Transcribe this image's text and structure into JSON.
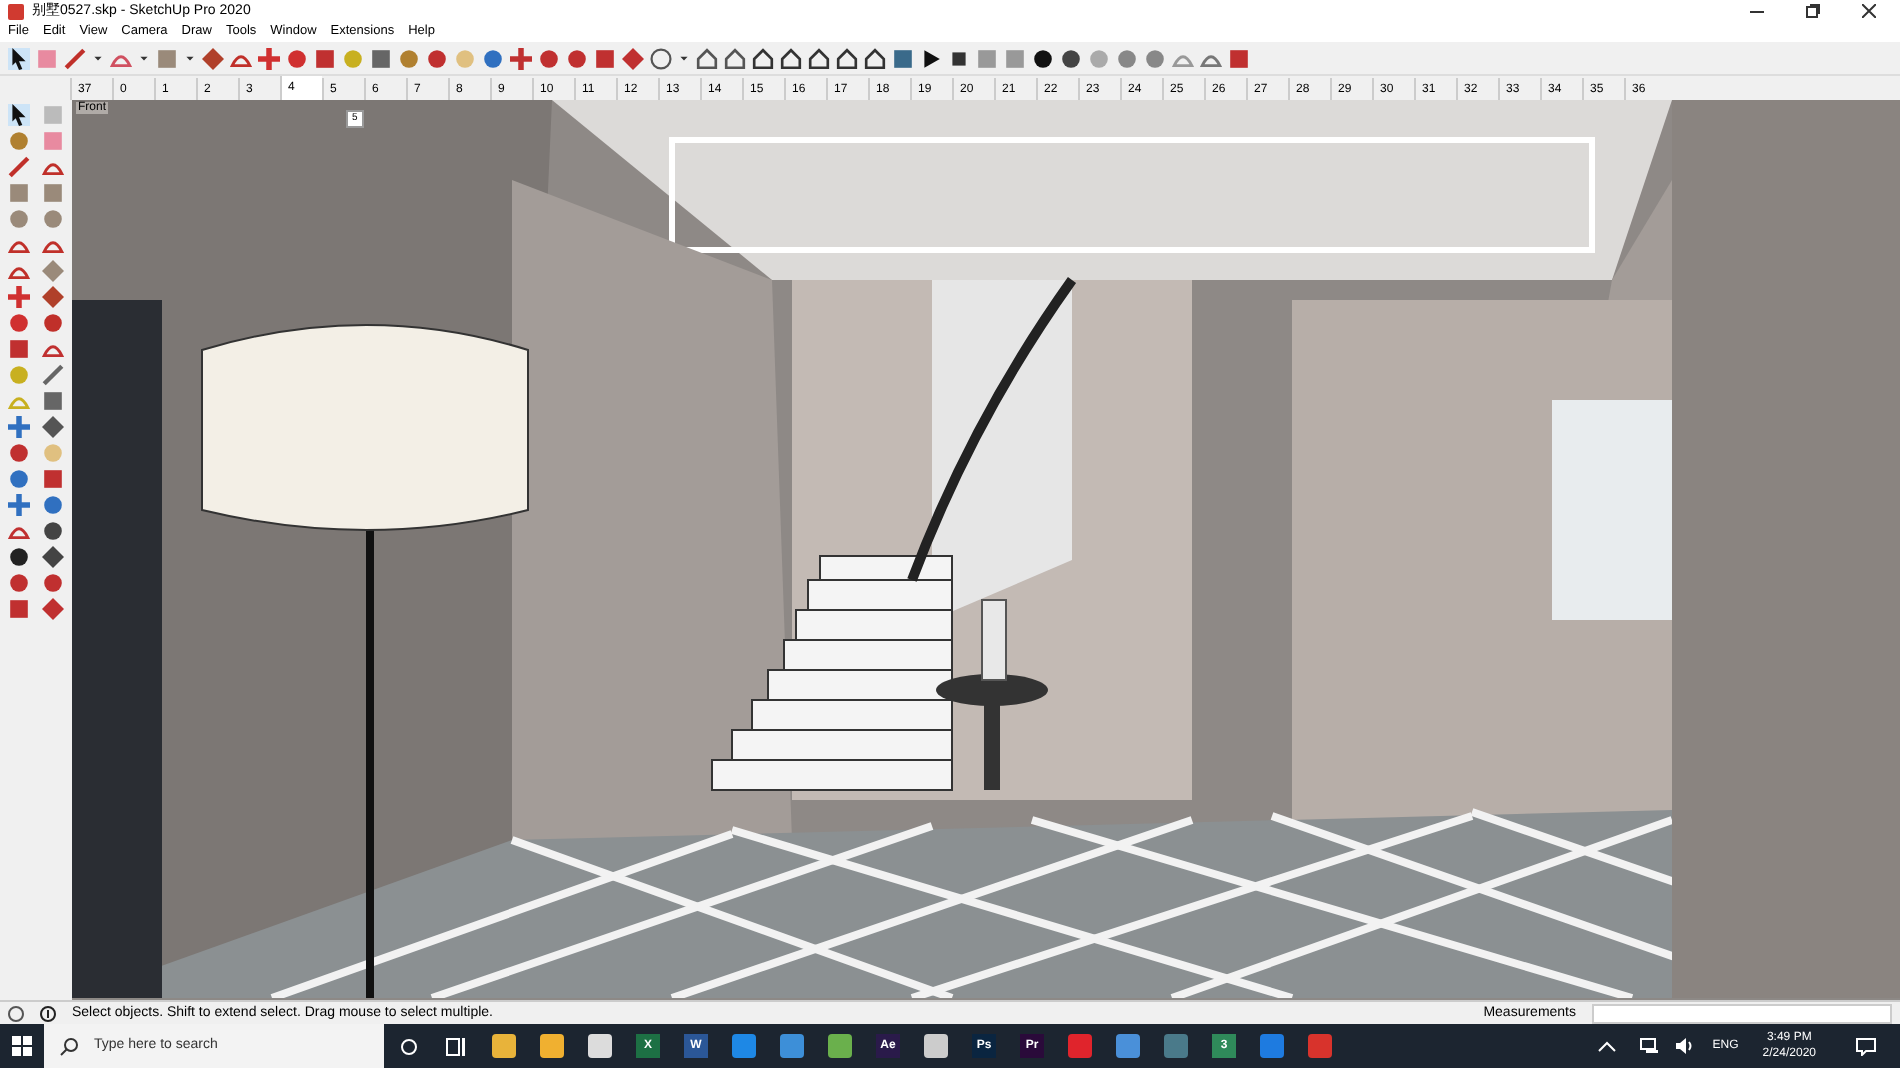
{
  "window": {
    "title": "别墅0527.skp - SketchUp Pro 2020"
  },
  "menu": [
    "File",
    "Edit",
    "View",
    "Camera",
    "Draw",
    "Tools",
    "Window",
    "Extensions",
    "Help"
  ],
  "scene_tabs": [
    {
      "label": "37",
      "selected": false
    },
    {
      "label": "0",
      "selected": false
    },
    {
      "label": "1",
      "selected": false
    },
    {
      "label": "2",
      "selected": false
    },
    {
      "label": "3",
      "selected": false
    },
    {
      "label": "4",
      "selected": true
    },
    {
      "label": "5",
      "selected": false
    },
    {
      "label": "6",
      "selected": false
    },
    {
      "label": "7",
      "selected": false
    },
    {
      "label": "8",
      "selected": false
    },
    {
      "label": "9",
      "selected": false
    },
    {
      "label": "10",
      "selected": false
    },
    {
      "label": "11",
      "selected": false
    },
    {
      "label": "12",
      "selected": false
    },
    {
      "label": "13",
      "selected": false
    },
    {
      "label": "14",
      "selected": false
    },
    {
      "label": "15",
      "selected": false
    },
    {
      "label": "16",
      "selected": false
    },
    {
      "label": "17",
      "selected": false
    },
    {
      "label": "18",
      "selected": false
    },
    {
      "label": "19",
      "selected": false
    },
    {
      "label": "20",
      "selected": false
    },
    {
      "label": "21",
      "selected": false
    },
    {
      "label": "22",
      "selected": false
    },
    {
      "label": "23",
      "selected": false
    },
    {
      "label": "24",
      "selected": false
    },
    {
      "label": "25",
      "selected": false
    },
    {
      "label": "26",
      "selected": false
    },
    {
      "label": "27",
      "selected": false
    },
    {
      "label": "28",
      "selected": false
    },
    {
      "label": "29",
      "selected": false
    },
    {
      "label": "30",
      "selected": false
    },
    {
      "label": "31",
      "selected": false
    },
    {
      "label": "32",
      "selected": false
    },
    {
      "label": "33",
      "selected": false
    },
    {
      "label": "34",
      "selected": false
    },
    {
      "label": "35",
      "selected": false
    },
    {
      "label": "36",
      "selected": false
    }
  ],
  "tab_tooltip": "5",
  "viewport": {
    "view_label": "Front"
  },
  "status_bar": {
    "message": "Select objects. Shift to extend select. Drag mouse to select multiple.",
    "measurements_label": "Measurements"
  },
  "taskbar": {
    "search_placeholder": "Type here to search",
    "apps": [
      {
        "kind": "icon",
        "color": "#e8b33a"
      },
      {
        "kind": "icon",
        "color": "#f0b030"
      },
      {
        "kind": "icon",
        "color": "#dcdcdc"
      },
      {
        "kind": "letter",
        "label": "X",
        "color": "#1d7044"
      },
      {
        "kind": "letter",
        "label": "W",
        "color": "#2b5797"
      },
      {
        "kind": "icon",
        "color": "#1e88e5"
      },
      {
        "kind": "icon",
        "color": "#3d8fd8"
      },
      {
        "kind": "icon",
        "color": "#6ab04c"
      },
      {
        "kind": "letter",
        "label": "Ae",
        "color": "#2a1a4a"
      },
      {
        "kind": "icon",
        "color": "#cccccc"
      },
      {
        "kind": "letter",
        "label": "Ps",
        "color": "#0a2540"
      },
      {
        "kind": "letter",
        "label": "Pr",
        "color": "#2a0a3a"
      },
      {
        "kind": "icon",
        "color": "#e0242c"
      },
      {
        "kind": "icon",
        "color": "#4a90d9"
      },
      {
        "kind": "icon",
        "color": "#4a7a8a"
      },
      {
        "kind": "letter",
        "label": "3",
        "color": "#2f8a5a"
      },
      {
        "kind": "icon",
        "color": "#1e7be0"
      },
      {
        "kind": "icon",
        "color": "#d8332c"
      }
    ],
    "language": "ENG",
    "time": "3:49 PM",
    "date": "2/24/2020"
  }
}
